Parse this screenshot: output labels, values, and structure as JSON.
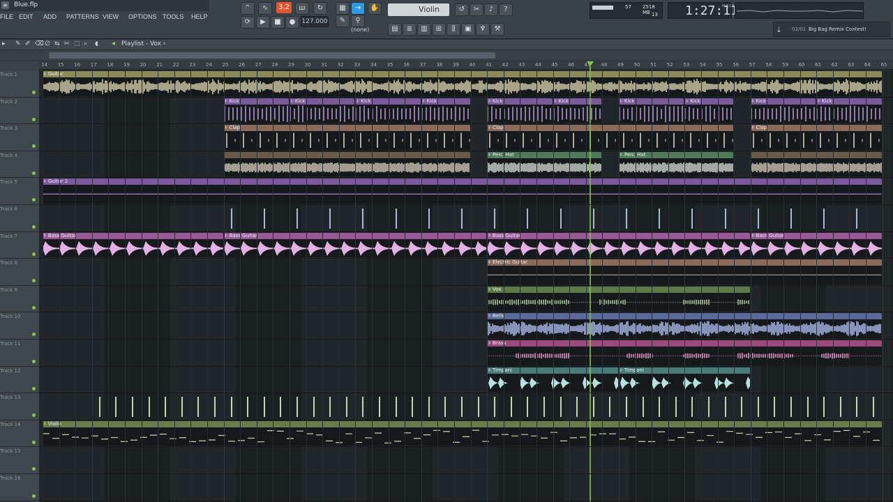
{
  "window": {
    "file_name": "Blue.flp"
  },
  "menu": [
    "FILE",
    "EDIT",
    "ADD",
    "PATTERNS",
    "VIEW",
    "OPTIONS",
    "TOOLS",
    "HELP"
  ],
  "transport": {
    "pattern_number": "3.2",
    "tempo": "127.000",
    "instrument": "Violin",
    "arp_none": "(none)"
  },
  "monitor": {
    "cpu": "57",
    "memory": "2518 MB",
    "polyphony": "13"
  },
  "time": {
    "display": "1:27:11",
    "unit": "M:S:CS"
  },
  "news": {
    "date": "02/01",
    "text": "Big Bag Remix Contest!"
  },
  "playlist": {
    "title": "Playlist - Vox",
    "separator": "›"
  },
  "ruler": {
    "bars": [
      "14",
      "15",
      "16",
      "17",
      "18",
      "19",
      "20",
      "21",
      "22",
      "23",
      "24",
      "25",
      "26",
      "27",
      "28",
      "29",
      "30",
      "31",
      "32",
      "33",
      "34",
      "35",
      "36",
      "37",
      "38",
      "39",
      "40",
      "41",
      "42",
      "43",
      "44",
      "45",
      "46",
      "47",
      "48",
      "49",
      "50",
      "51",
      "52",
      "53",
      "54",
      "55",
      "56",
      "57",
      "58",
      "59",
      "60",
      "61",
      "62",
      "63",
      "64",
      "65"
    ]
  },
  "tracks": [
    "Track 1",
    "Track 2",
    "Track 3",
    "Track 4",
    "Track 5",
    "Track 6",
    "Track 7",
    "Track 8",
    "Track 9",
    "Track 10",
    "Track 11",
    "Track 12",
    "Track 13",
    "Track 14",
    "Track 15",
    "Track 16"
  ],
  "colors": {
    "guitar": "#8a8a5a",
    "kick": "#7a5a9a",
    "clap": "#8a6a5a",
    "perc": "#4f7a5a",
    "guitar2": "#7a5a9a",
    "bass": "#9a5a9a",
    "electric": "#8a6a5a",
    "vox": "#5f7a4a",
    "bells": "#5a6a9a",
    "brass": "#9a4a7a",
    "timpani": "#4a7a7a",
    "violin": "#6a7a4a",
    "playhead": "#7fc143"
  },
  "clips": [
    {
      "label": "Guitar",
      "track": 0,
      "start": 14,
      "end": 65,
      "color": "#8a8a5a",
      "wave": "#d9d2b0",
      "kind": "wave"
    },
    {
      "label": "Kick",
      "track": 1,
      "start": 25,
      "end": 29,
      "color": "#7a5a9a",
      "wave": "#c6a8e6",
      "kind": "hits"
    },
    {
      "label": "Kick",
      "track": 1,
      "start": 29,
      "end": 33,
      "color": "#7a5a9a",
      "wave": "#c6a8e6",
      "kind": "hits"
    },
    {
      "label": "Kick",
      "track": 1,
      "start": 33,
      "end": 37,
      "color": "#7a5a9a",
      "wave": "#c6a8e6",
      "kind": "hits"
    },
    {
      "label": "Kick",
      "track": 1,
      "start": 37,
      "end": 40,
      "color": "#7a5a9a",
      "wave": "#c6a8e6",
      "kind": "hits"
    },
    {
      "label": "Kick",
      "track": 1,
      "start": 41,
      "end": 45,
      "color": "#7a5a9a",
      "wave": "#c6a8e6",
      "kind": "hits"
    },
    {
      "label": "Kick",
      "track": 1,
      "start": 45,
      "end": 48,
      "color": "#7a5a9a",
      "wave": "#c6a8e6",
      "kind": "hits"
    },
    {
      "label": "Kick",
      "track": 1,
      "start": 49,
      "end": 53,
      "color": "#7a5a9a",
      "wave": "#c6a8e6",
      "kind": "hits"
    },
    {
      "label": "Kick",
      "track": 1,
      "start": 53,
      "end": 56,
      "color": "#7a5a9a",
      "wave": "#c6a8e6",
      "kind": "hits"
    },
    {
      "label": "Kick",
      "track": 1,
      "start": 57,
      "end": 61,
      "color": "#7a5a9a",
      "wave": "#c6a8e6",
      "kind": "hits"
    },
    {
      "label": "Kick",
      "track": 1,
      "start": 61,
      "end": 65,
      "color": "#7a5a9a",
      "wave": "#c6a8e6",
      "kind": "hits"
    },
    {
      "label": "Clap",
      "track": 2,
      "start": 25,
      "end": 40,
      "color": "#8a6a5a",
      "wave": "#e9dccf",
      "kind": "sparse"
    },
    {
      "label": "Clap",
      "track": 2,
      "start": 41,
      "end": 56,
      "color": "#8a6a5a",
      "wave": "#e9dccf",
      "kind": "sparse"
    },
    {
      "label": "Clap",
      "track": 2,
      "start": 57,
      "end": 65,
      "color": "#8a6a5a",
      "wave": "#e9dccf",
      "kind": "sparse"
    },
    {
      "label": "",
      "track": 3,
      "start": 25,
      "end": 40,
      "color": "#6a5a4a",
      "wave": "#e0d6c6",
      "kind": "dense"
    },
    {
      "label": "Perc_Hat",
      "track": 3,
      "start": 41,
      "end": 48,
      "color": "#4f7a5a",
      "wave": "#e0e8e2",
      "kind": "dense"
    },
    {
      "label": "Perc_Hat",
      "track": 3,
      "start": 49,
      "end": 56,
      "color": "#4f7a5a",
      "wave": "#e0e8e2",
      "kind": "dense"
    },
    {
      "label": "",
      "track": 3,
      "start": 57,
      "end": 65,
      "color": "#6a5a4a",
      "wave": "#e0d6c6",
      "kind": "dense"
    },
    {
      "label": "Guitar 2",
      "track": 4,
      "start": 14,
      "end": 65,
      "color": "#7a5a9a",
      "wave": "#c6a8e6",
      "kind": "flat"
    },
    {
      "label": "Bass Guitar",
      "track": 6,
      "start": 14,
      "end": 25,
      "color": "#9a5a9a",
      "wave": "#e3b0e3",
      "kind": "bass"
    },
    {
      "label": "Bass Guitar",
      "track": 6,
      "start": 25,
      "end": 41,
      "color": "#9a5a9a",
      "wave": "#e3b0e3",
      "kind": "bass"
    },
    {
      "label": "Bass Guitar",
      "track": 6,
      "start": 41,
      "end": 57,
      "color": "#9a5a9a",
      "wave": "#e3b0e3",
      "kind": "bass"
    },
    {
      "label": "Bass Guitar",
      "track": 6,
      "start": 57,
      "end": 65,
      "color": "#9a5a9a",
      "wave": "#e3b0e3",
      "kind": "bass"
    },
    {
      "label": "Electric Guitar",
      "track": 7,
      "start": 41,
      "end": 65,
      "color": "#8a6a5a",
      "wave": "#c9b9a8",
      "kind": "flat"
    },
    {
      "label": "Vox",
      "track": 8,
      "start": 41,
      "end": 57,
      "color": "#5f7a4a",
      "wave": "#bcd0a8",
      "kind": "vox"
    },
    {
      "label": "Bells",
      "track": 9,
      "start": 41,
      "end": 65,
      "color": "#5a6a9a",
      "wave": "#aebcf0",
      "kind": "wave"
    },
    {
      "label": "Brass",
      "track": 10,
      "start": 41,
      "end": 65,
      "color": "#9a4a7a",
      "wave": "#f0a0d0",
      "kind": "vox"
    },
    {
      "label": "Timpani",
      "track": 11,
      "start": 41,
      "end": 49,
      "color": "#4a7a7a",
      "wave": "#b8e0e0",
      "kind": "timp"
    },
    {
      "label": "Timpani",
      "track": 11,
      "start": 49,
      "end": 57,
      "color": "#4a7a7a",
      "wave": "#b8e0e0",
      "kind": "timp"
    },
    {
      "label": "Violin",
      "track": 13,
      "start": 14,
      "end": 65,
      "color": "#6a7a4a",
      "wave": "#c8d4b0",
      "kind": "notes"
    }
  ]
}
